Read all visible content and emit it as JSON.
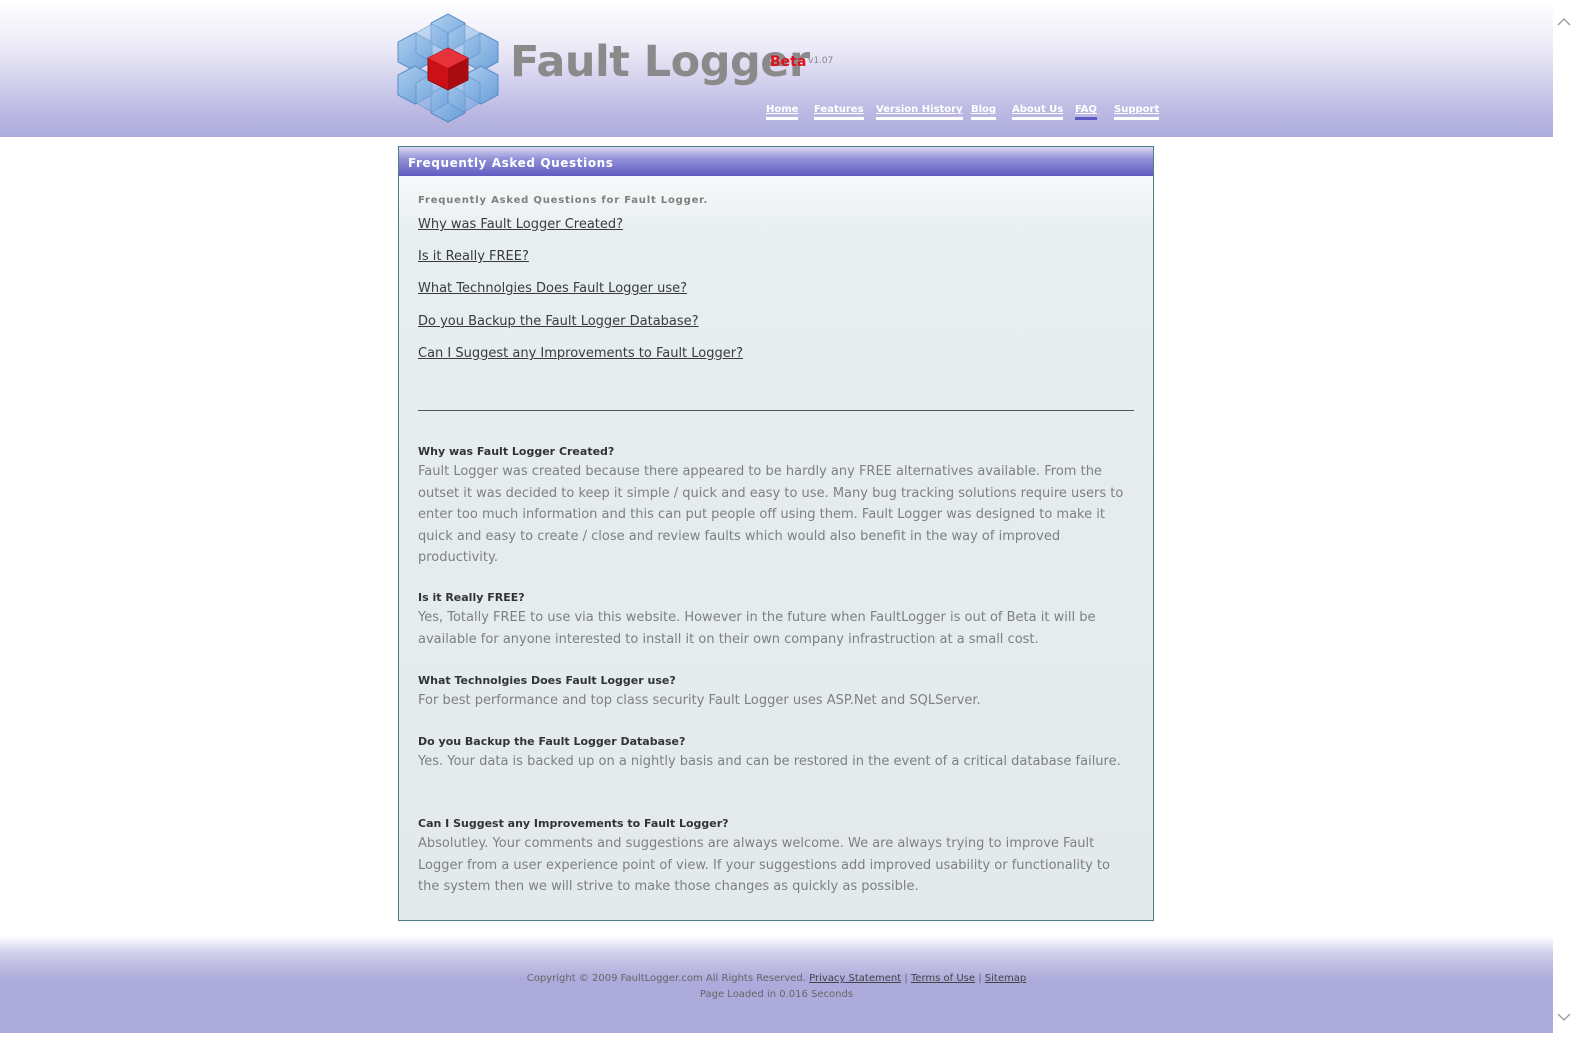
{
  "header": {
    "title": "Fault Logger",
    "beta_label": "Beta",
    "version": "v1.07",
    "nav": [
      {
        "label": "Home"
      },
      {
        "label": "Features"
      },
      {
        "label": "Version History"
      },
      {
        "label": "Blog"
      },
      {
        "label": "About Us"
      },
      {
        "label": "FAQ",
        "active": true
      },
      {
        "label": "Support"
      }
    ]
  },
  "panel": {
    "title": "Frequently Asked Questions",
    "intro": "Frequently Asked Questions for Fault Logger.",
    "toc": [
      "Why was Fault Logger Created?",
      "Is it Really FREE?",
      "What Technolgies Does Fault Logger use?",
      "Do you Backup the Fault Logger Database?",
      "Can I Suggest any Improvements to Fault Logger?"
    ],
    "faqs": [
      {
        "question": "Why was Fault Logger Created?",
        "answer": "Fault Logger was created because there appeared to be hardly any FREE alternatives available. From the outset it was decided to keep it simple / quick and easy to use. Many bug tracking solutions require users to enter too much information and this can put people off using them. Fault Logger was designed to make it quick and easy to create / close and review faults which would also benefit in the way of improved productivity."
      },
      {
        "question": "Is it Really FREE?",
        "answer": "Yes, Totally FREE to use via this website. However in the future when FaultLogger is out of Beta it will be available for anyone interested to install it on their own company infrastruction at a small cost."
      },
      {
        "question": "What Technolgies Does Fault Logger use?",
        "answer": "For best performance and top class security Fault Logger uses ASP.Net and SQLServer."
      },
      {
        "question": "Do you Backup the Fault Logger Database?",
        "answer": "Yes. Your data is backed up on a nightly basis and can be restored in the event of a critical database failure."
      },
      {
        "question": "Can I Suggest any Improvements to Fault Logger?",
        "answer": "Absolutley. Your comments and suggestions are always welcome. We are always trying to improve Fault Logger from a user experience point of view. If your suggestions add improved usability or functionality to the system then we will strive to make those changes as quickly as possible."
      }
    ]
  },
  "footer": {
    "copyright": "Copyright © 2009 FaultLogger.com All Rights Reserved.",
    "privacy": "Privacy Statement",
    "separator": "|",
    "terms": "Terms of Use",
    "sitemap": "Sitemap",
    "page_loaded": "Page Loaded in 0.016 Seconds"
  },
  "colors": {
    "header_bg": "#adabdb",
    "panel_header": "#5d5bc0",
    "panel_border": "#4f7f86",
    "beta_red": "#e0101a",
    "nav_active": "#5c59c7"
  },
  "icons": {
    "logo": "cube-cluster-logo-icon",
    "scroll_up": "chevron-up-icon",
    "scroll_down": "chevron-down-icon"
  }
}
